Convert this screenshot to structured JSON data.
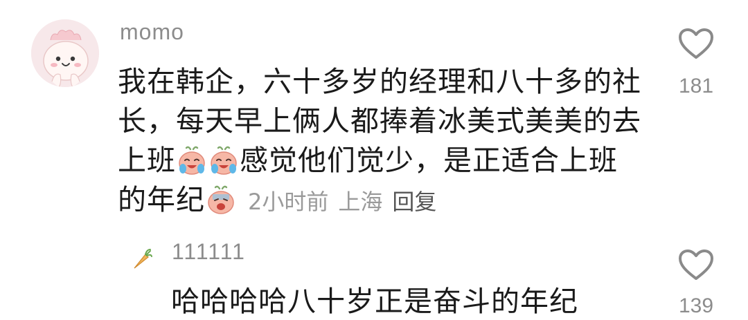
{
  "comment": {
    "username": "momo",
    "text_parts": [
      "我在韩企，六十多岁的经理和八十多的社长，每天早上俩人都捧着冰美式美美的去上班",
      "感觉他们觉少，是正适合上班的年纪"
    ],
    "emojis": [
      "laugh-cry-emoji",
      "laugh-cry-emoji",
      "cry-emoji"
    ],
    "time": "2小时前",
    "location": "上海",
    "reply_label": "回复",
    "like_count": "181"
  },
  "reply": {
    "username": "111111",
    "text": "哈哈哈哈八十岁正是奋斗的年纪",
    "like_count": "139",
    "badge_icon": "carrot-icon"
  },
  "colors": {
    "text": "#1a1a1a",
    "meta": "#9a9a9a",
    "username": "#8c8c8c",
    "icon_stroke": "#8a8a8a"
  }
}
